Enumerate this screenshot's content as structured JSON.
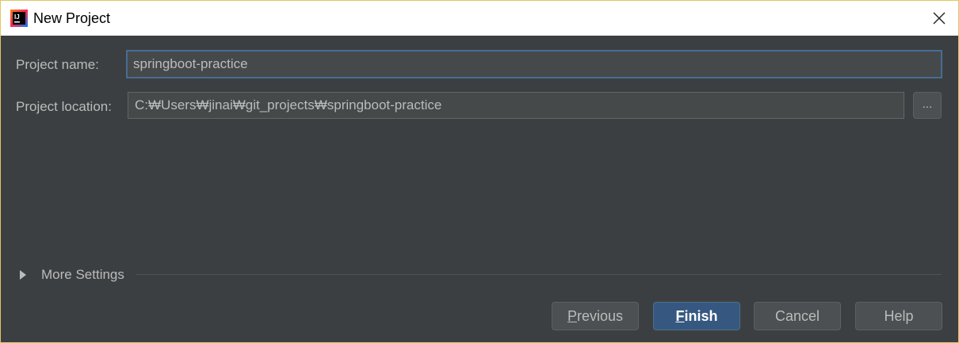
{
  "window": {
    "title": "New Project",
    "icon": "intellij-idea-icon",
    "close_icon": "close-icon"
  },
  "form": {
    "project_name": {
      "label": "Project name:",
      "value": "springboot-practice"
    },
    "project_location": {
      "label": "Project location:",
      "value": "C:₩Users₩jinai₩git_projects₩springboot-practice",
      "browse_label": "..."
    }
  },
  "more_settings": {
    "label": "More Settings",
    "expanded": false
  },
  "buttons": {
    "previous": {
      "mnemonic": "P",
      "rest": "revious"
    },
    "finish": {
      "mnemonic": "F",
      "rest": "inish"
    },
    "cancel": {
      "label": "Cancel"
    },
    "help": {
      "label": "Help"
    }
  },
  "colors": {
    "background": "#3c3f41",
    "field_background": "#45494a",
    "focus_border": "#466d94",
    "primary_button": "#365880",
    "text": "#bbbbbb"
  }
}
